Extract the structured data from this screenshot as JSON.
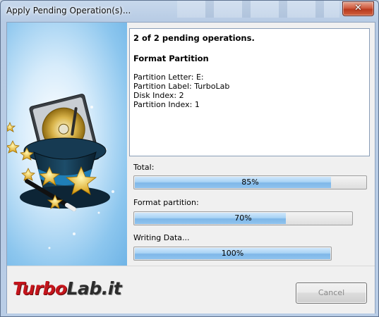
{
  "window": {
    "title": "Apply Pending Operation(s)...",
    "close_glyph": "✕"
  },
  "info": {
    "header": "2 of 2 pending operations.",
    "operation": "Format Partition",
    "details": [
      "Partition Letter: E:",
      "Partition Label: TurboLab",
      "Disk Index: 2",
      "Partition Index: 1"
    ]
  },
  "progress": {
    "total": {
      "label": "Total:",
      "value": 85,
      "text": "85%"
    },
    "step": {
      "label": "Format partition:",
      "value": 70,
      "text": "70%"
    },
    "sub": {
      "label": "Writing Data...",
      "value": 100,
      "text": "100%"
    }
  },
  "logo": {
    "part1": "Turbo",
    "part2": "Lab.it"
  },
  "buttons": {
    "cancel": "Cancel"
  },
  "colors": {
    "progress_fill": "#8fc3ee",
    "logo_red": "#c4151c"
  },
  "icons": {
    "art": "magic-hat-hard-disk-icon",
    "close": "close-icon"
  }
}
